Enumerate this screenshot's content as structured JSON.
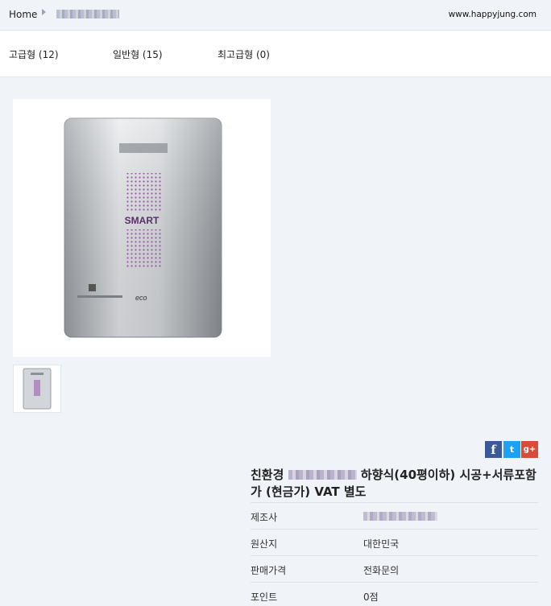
{
  "breadcrumb": {
    "home": "Home"
  },
  "header": {
    "site_url": "www.happyjung.com"
  },
  "categories": [
    {
      "label": "고급형 (12)"
    },
    {
      "label": "일반형 (15)"
    },
    {
      "label": "최고급형 (0)"
    }
  ],
  "product": {
    "image_badge": "SMART",
    "image_logo": "eco",
    "title_prefix": "친환경",
    "title_suffix": "하향식(40평이하) 시공+서류포함가 (현금가) VAT 별도",
    "share": {
      "facebook": "f",
      "twitter": "t",
      "google": "g+"
    },
    "info": [
      {
        "label": "제조사",
        "value": ""
      },
      {
        "label": "원산지",
        "value": "대한민국"
      },
      {
        "label": "판매가격",
        "value": "전화문의"
      },
      {
        "label": "포인트",
        "value": "0점"
      }
    ]
  },
  "colors": {
    "facebook": "#3b5998",
    "twitter": "#1da1f2",
    "google": "#d94a38"
  }
}
